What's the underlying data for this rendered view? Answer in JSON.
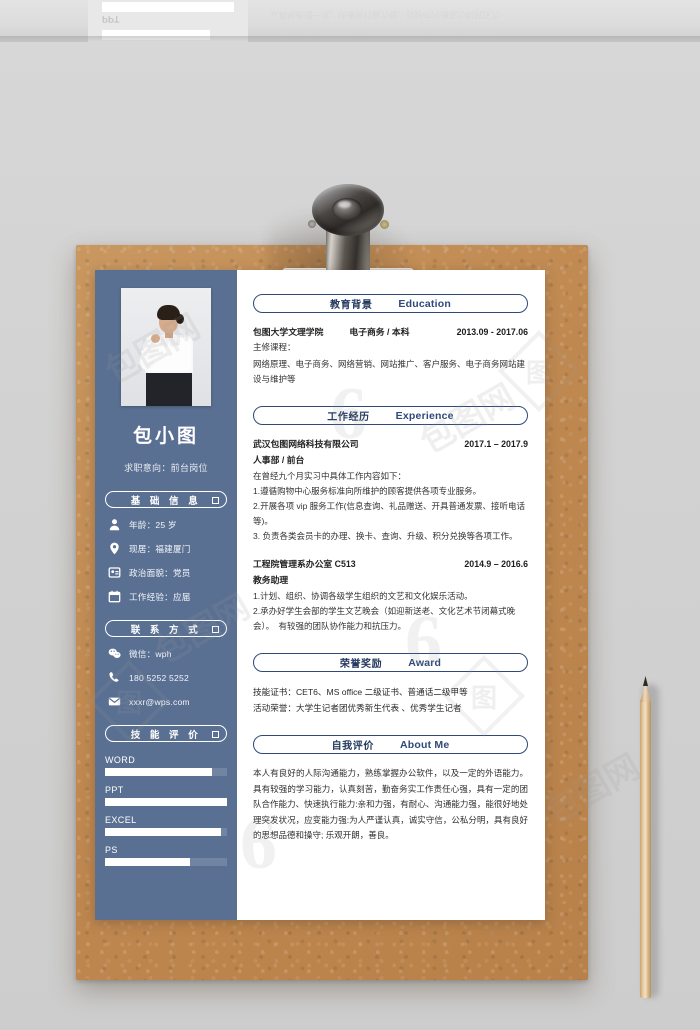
{
  "scene": {
    "background_color": "#d2d2d2",
    "clipboard_color": "#c08a52",
    "paper_color": "#ffffff",
    "sidebar_color": "#5a7092",
    "accent_color": "#2f4a78",
    "objects": [
      "clipboard",
      "metal-clip",
      "resume-paper",
      "pencil"
    ]
  },
  "reflection": {
    "label": "PPT",
    "line1": "的第一印象，要有耐心沟通能力强，能很好地处理突发状况，",
    "line2": "认真地处理一次，快速执行能力强，良好的沟通能力和抗压力"
  },
  "watermark": {
    "digit": "6",
    "brand": "包图网",
    "box_char": "图"
  },
  "sidebar": {
    "photo": {
      "name": "profile-photo",
      "alt": "woman in white shirt and black skirt"
    },
    "name": "包小图",
    "intent_label": "求职意向：前台岗位",
    "sections": [
      {
        "title": "基 础 信 息",
        "key": "basic-info"
      },
      {
        "title": "联 系 方 式",
        "key": "contact"
      },
      {
        "title": "技 能 评 价",
        "key": "skills"
      }
    ],
    "basic_info": [
      {
        "icon": "person-icon",
        "text": "年龄：25 岁"
      },
      {
        "icon": "location-icon",
        "text": "现居：福建厦门"
      },
      {
        "icon": "id-card-icon",
        "text": "政治面貌：党员"
      },
      {
        "icon": "calendar-icon",
        "text": "工作经验：应届"
      }
    ],
    "contact": [
      {
        "icon": "wechat-icon",
        "text": "微信：wph"
      },
      {
        "icon": "phone-icon",
        "text": "180 5252 5252"
      },
      {
        "icon": "mail-icon",
        "text": "xxxr@wps.com"
      }
    ],
    "skills": [
      {
        "name": "WORD",
        "percent": 88
      },
      {
        "name": "PPT",
        "percent": 100
      },
      {
        "name": "EXCEL",
        "percent": 95
      },
      {
        "name": "PS",
        "percent": 70
      }
    ]
  },
  "main": {
    "education": {
      "head_cn": "教育背景",
      "head_en": "Education",
      "school": "包图大学文理学院",
      "major": "电子商务 / 本科",
      "date": "2013.09 - 2017.06",
      "courses_label": "主修课程：",
      "courses": "网络原理、电子商务、网络营销、网站推广、客户服务、电子商务网站建设与维护等"
    },
    "experience": {
      "head_cn": "工作经历",
      "head_en": "Experience",
      "jobs": [
        {
          "org": "武汉包图网络科技有限公司",
          "date": "2017.1 – 2017.9",
          "role": "人事部 / 前台",
          "intro": "在曾经九个月实习中具体工作内容如下：",
          "bullets": [
            "1.遵循购物中心服务标准向所维护的顾客提供各项专业服务。",
            "2.开展各项 vip 服务工作(信息查询、礼品赠送、开具普通发票、接听电话等)。",
            "3. 负责各类会员卡的办理、换卡、查询、升级、积分兑换等各项工作。"
          ]
        },
        {
          "org": "工程院管理系办公室 C513",
          "date": "2014.9 – 2016.6",
          "role": "教务助理",
          "intro": "",
          "bullets": [
            "1.计划、组织、协调各级学生组织的文艺和文化娱乐活动。",
            "2.承办好学生会部的学生文艺晚会（如迎新送老、文化艺术节闭幕式晚会）。　有较强的团队协作能力和抗压力。"
          ]
        }
      ]
    },
    "award": {
      "head_cn": "荣誉奖励",
      "head_en": "Award",
      "lines": [
        "技能证书：CET6、MS office 二级证书、普通话二级甲等",
        "活动荣誉：大学生记者团优秀新生代表 、优秀学生记者"
      ]
    },
    "about": {
      "head_cn": "自我评价",
      "head_en": "About Me",
      "text": "本人有良好的人际沟通能力，熟练掌握办公软件，以及一定的外语能力。具有较强的学习能力，认真刻苦，勤奋务实工作责任心强，具有一定的团队合作能力、快速执行能力:亲和力强，有耐心、沟通能力强，能很好地处理突发状况，应变能力强:为人严谨认真，诚实守信，公私分明，具有良好的思想品德和操守; 乐观开朗，善良。"
    }
  }
}
